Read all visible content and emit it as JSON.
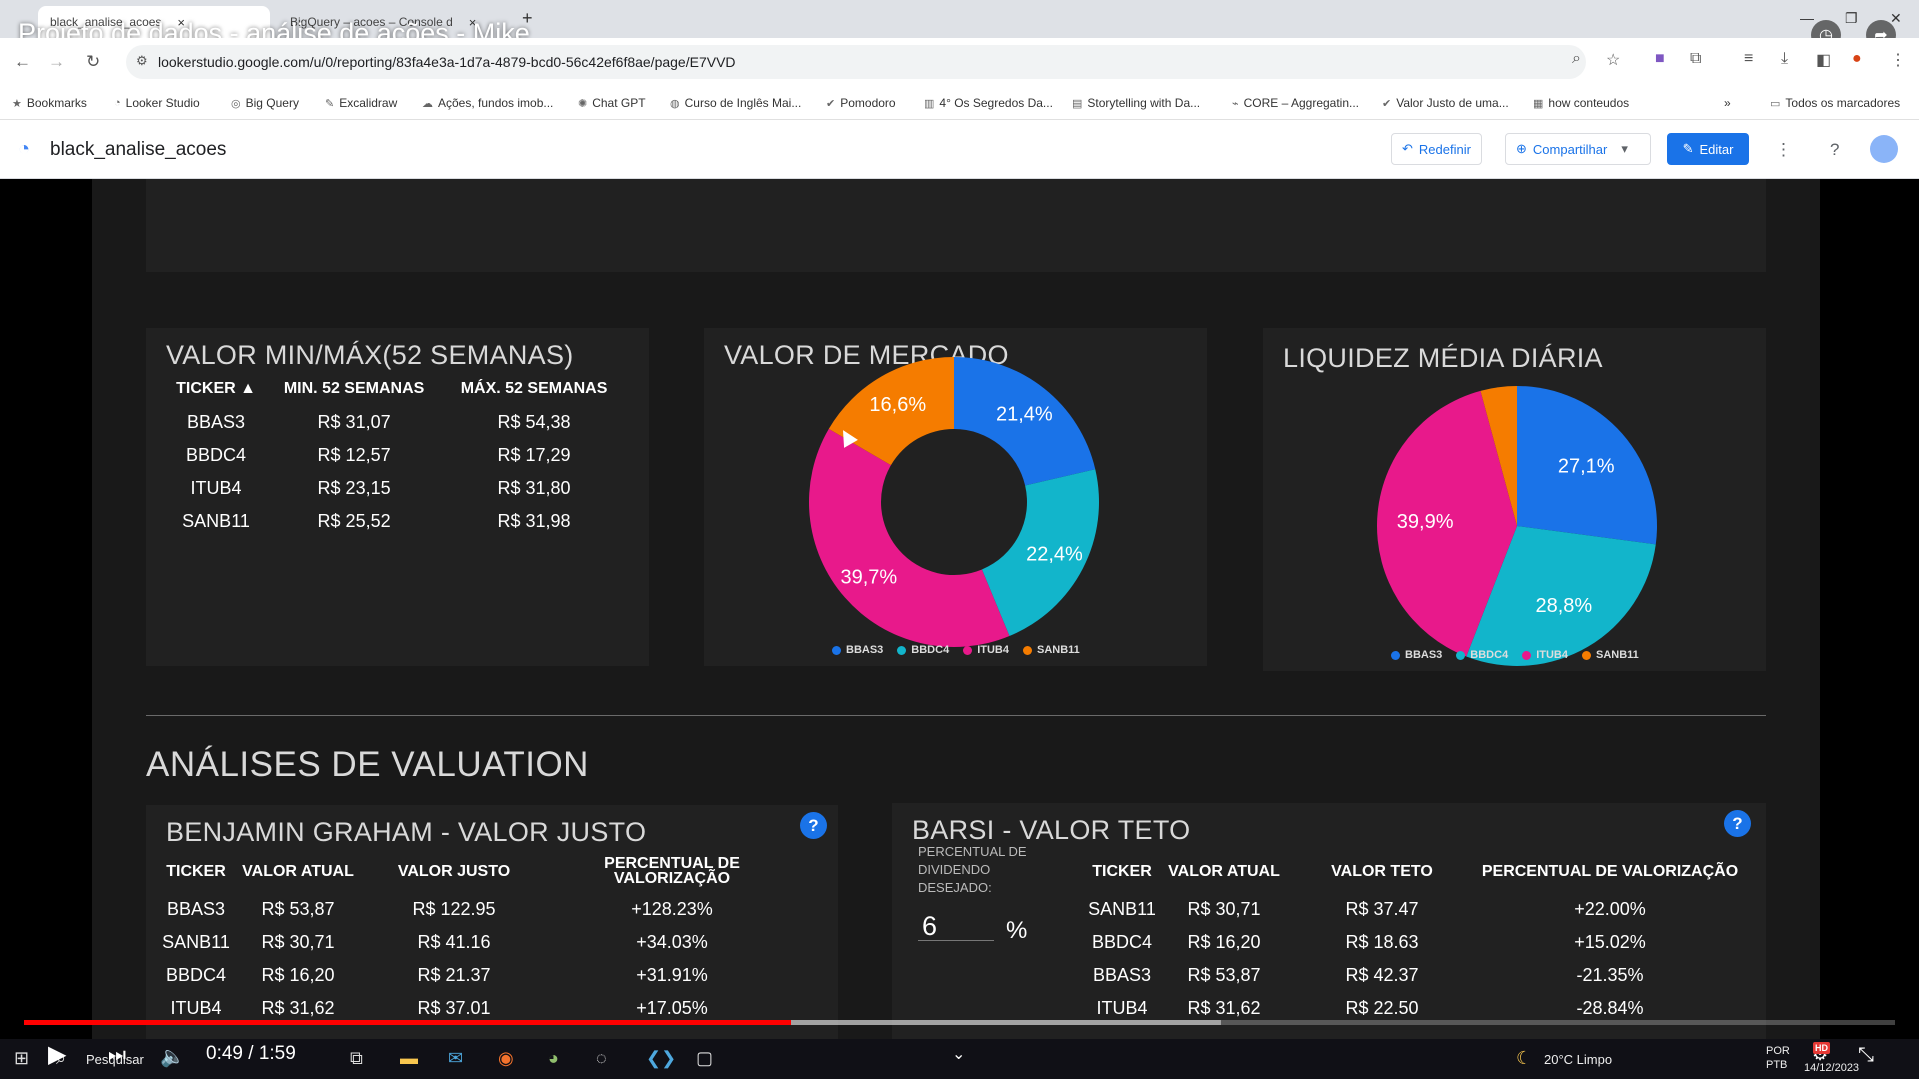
{
  "video": {
    "title": "Projeto de dados - análise de ações - Mike",
    "time": "0:49 / 1:59",
    "progress_fraction": 0.41,
    "buffered_fraction": 0.64
  },
  "browser": {
    "tabs": [
      {
        "label": "black_analise_acoes",
        "close": "×"
      },
      {
        "label": "BigQuery – acoes – Console d",
        "close": "×"
      }
    ],
    "new_tab": "+",
    "url": "lookerstudio.google.com/u/0/reporting/83fa4e3a-1d7a-4879-bcd0-56c42ef6f8ae/page/E7VVD",
    "bookmarks": [
      {
        "label": "Bookmarks",
        "icon": "star-icon"
      },
      {
        "label": "Looker Studio",
        "icon": "looker-icon"
      },
      {
        "label": "Big Query",
        "icon": "bigquery-icon"
      },
      {
        "label": "Excalidraw",
        "icon": "excalidraw-icon"
      },
      {
        "label": "Ações, fundos imob...",
        "icon": "chart-icon"
      },
      {
        "label": "Chat GPT",
        "icon": "chatgpt-icon"
      },
      {
        "label": "Curso de Inglês Mai...",
        "icon": "globe-icon"
      },
      {
        "label": "Pomodoro",
        "icon": "check-icon"
      },
      {
        "label": "4° Os Segredos Da...",
        "icon": "book-icon"
      },
      {
        "label": "Storytelling with Da...",
        "icon": "pdf-icon"
      },
      {
        "label": "CORE – Aggregatin...",
        "icon": "core-icon"
      },
      {
        "label": "Valor Justo de uma...",
        "icon": "check-icon"
      },
      {
        "label": "how conteudos",
        "icon": "notion-icon"
      }
    ],
    "bookmarks_more": "»",
    "all_bookmarks": "Todos os marcadores"
  },
  "looker": {
    "report_title": "black_analise_acoes",
    "reset_label": "Redefinir",
    "share_label": "Compartilhar",
    "edit_label": "Editar"
  },
  "minmax": {
    "title": "VALOR MIN/MÁX(52 SEMANAS)",
    "headers": [
      "TICKER ▲",
      "MIN. 52 SEMANAS",
      "MÁX. 52 SEMANAS"
    ],
    "rows": [
      [
        "BBAS3",
        "R$ 31,07",
        "R$ 54,38"
      ],
      [
        "BBDC4",
        "R$ 12,57",
        "R$ 17,29"
      ],
      [
        "ITUB4",
        "R$ 23,15",
        "R$ 31,80"
      ],
      [
        "SANB11",
        "R$ 25,52",
        "R$ 31,98"
      ]
    ]
  },
  "market_value": {
    "title": "VALOR DE MERCADO",
    "legend": [
      "BBAS3",
      "BBDC4",
      "ITUB4",
      "SANB11"
    ]
  },
  "liquidity": {
    "title": "LIQUIDEZ MÉDIA DIÁRIA",
    "legend": [
      "BBAS3",
      "BBDC4",
      "ITUB4",
      "SANB11"
    ]
  },
  "chart_data": [
    {
      "type": "pie",
      "title": "VALOR DE MERCADO",
      "categories": [
        "BBAS3",
        "BBDC4",
        "ITUB4",
        "SANB11"
      ],
      "values": [
        21.4,
        22.4,
        39.7,
        16.6
      ],
      "labels": [
        "21,4%",
        "22,4%",
        "39,7%",
        "16,6%"
      ],
      "colors": [
        "#1a73e8",
        "#12b5cb",
        "#e8198b",
        "#f57c00"
      ],
      "donut": true,
      "legend": "bottom"
    },
    {
      "type": "pie",
      "title": "LIQUIDEZ MÉDIA DIÁRIA",
      "categories": [
        "BBAS3",
        "BBDC4",
        "ITUB4",
        "SANB11"
      ],
      "values": [
        27.1,
        28.8,
        39.9,
        4.2
      ],
      "labels": [
        "27,1%",
        "28,8%",
        "39,9%",
        ""
      ],
      "colors": [
        "#1a73e8",
        "#12b5cb",
        "#e8198b",
        "#f57c00"
      ],
      "donut": false,
      "legend": "bottom"
    }
  ],
  "valuation": {
    "section_title": "ANÁLISES DE VALUATION",
    "graham": {
      "title": "BENJAMIN GRAHAM - VALOR JUSTO",
      "help": "?",
      "headers": [
        "TICKER",
        "VALOR ATUAL",
        "VALOR JUSTO",
        "PERCENTUAL DE VALORIZAÇÃO"
      ],
      "rows": [
        [
          "BBAS3",
          "R$ 53,87",
          "R$ 122.95",
          "+128.23%"
        ],
        [
          "SANB11",
          "R$ 30,71",
          "R$ 41.16",
          "+34.03%"
        ],
        [
          "BBDC4",
          "R$ 16,20",
          "R$ 21.37",
          "+31.91%"
        ],
        [
          "ITUB4",
          "R$ 31,62",
          "R$ 37.01",
          "+17.05%"
        ]
      ]
    },
    "barsi": {
      "title": "BARSI - VALOR TETO",
      "help": "?",
      "dividend_label": "PERCENTUAL DE DIVIDENDO DESEJADO:",
      "dividend_value": "6",
      "dividend_unit": "%",
      "headers": [
        "TICKER",
        "VALOR ATUAL",
        "VALOR TETO",
        "PERCENTUAL DE VALORIZAÇÃO"
      ],
      "rows": [
        [
          "SANB11",
          "R$ 30,71",
          "R$ 37.47",
          "+22.00%"
        ],
        [
          "BBDC4",
          "R$ 16,20",
          "R$ 18.63",
          "+15.02%"
        ],
        [
          "BBAS3",
          "R$ 53,87",
          "R$ 42.37",
          "-21.35%"
        ],
        [
          "ITUB4",
          "R$ 31,62",
          "R$ 22.50",
          "-28.84%"
        ]
      ]
    }
  },
  "taskbar": {
    "search": "Pesquisar",
    "weather": "20°C  Limpo",
    "lang": "POR PTB",
    "date": "14/12/2023",
    "hd": "HD"
  }
}
